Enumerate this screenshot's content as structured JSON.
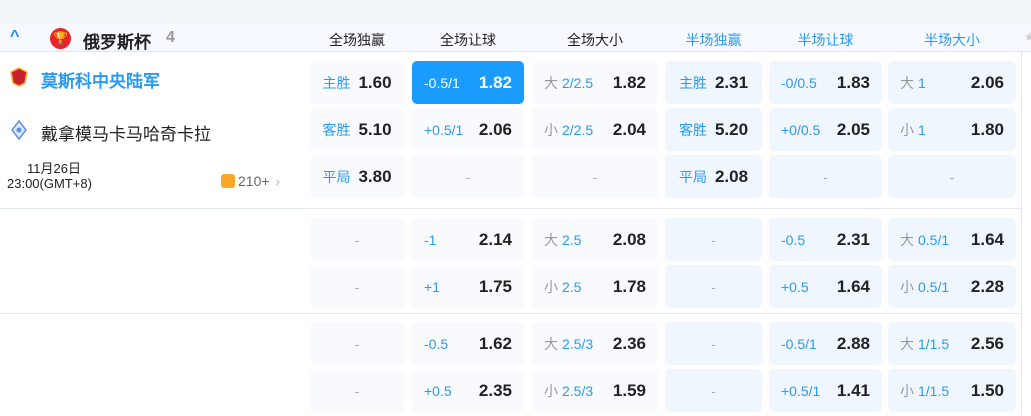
{
  "league": {
    "name": "俄罗斯杯",
    "count": "4",
    "icon": "trophy-icon",
    "color": "#e8232a"
  },
  "columns": [
    {
      "label": "全场独赢",
      "type": "ft"
    },
    {
      "label": "全场让球",
      "type": "ft"
    },
    {
      "label": "全场大小",
      "type": "ft"
    },
    {
      "label": "半场独赢",
      "type": "ht"
    },
    {
      "label": "半场让球",
      "type": "ht"
    },
    {
      "label": "半场大小",
      "type": "ht"
    }
  ],
  "match": {
    "home": "莫斯科中央陆军",
    "away": "戴拿模马卡马哈奇卡拉",
    "date": "11月26日",
    "time": "23:00(GMT+8)",
    "more": "210+"
  },
  "colors": {
    "accent": "#1a9cff",
    "blue_text": "#2b9af3"
  },
  "groups": [
    [
      [
        {
          "pre": "",
          "line": "主胜",
          "odds": "1.60"
        },
        {
          "pre": "",
          "line": "-0.5/1",
          "odds": "1.82",
          "selected": true
        },
        {
          "pre": "大",
          "line": "2/2.5",
          "odds": "1.82"
        },
        {
          "pre": "",
          "line": "主胜",
          "odds": "2.31"
        },
        {
          "pre": "",
          "line": "-0/0.5",
          "odds": "1.83"
        },
        {
          "pre": "大",
          "line": "1",
          "odds": "2.06"
        }
      ],
      [
        {
          "pre": "",
          "line": "客胜",
          "odds": "5.10"
        },
        {
          "pre": "",
          "line": "+0.5/1",
          "odds": "2.06"
        },
        {
          "pre": "小",
          "line": "2/2.5",
          "odds": "2.04"
        },
        {
          "pre": "",
          "line": "客胜",
          "odds": "5.20"
        },
        {
          "pre": "",
          "line": "+0/0.5",
          "odds": "2.05"
        },
        {
          "pre": "小",
          "line": "1",
          "odds": "1.80"
        }
      ],
      [
        {
          "pre": "",
          "line": "平局",
          "odds": "3.80"
        },
        null,
        null,
        {
          "pre": "",
          "line": "平局",
          "odds": "2.08"
        },
        null,
        null
      ]
    ],
    [
      [
        null,
        {
          "pre": "",
          "line": "-1",
          "odds": "2.14"
        },
        {
          "pre": "大",
          "line": "2.5",
          "odds": "2.08"
        },
        null,
        {
          "pre": "",
          "line": "-0.5",
          "odds": "2.31"
        },
        {
          "pre": "大",
          "line": "0.5/1",
          "odds": "1.64"
        }
      ],
      [
        null,
        {
          "pre": "",
          "line": "+1",
          "odds": "1.75"
        },
        {
          "pre": "小",
          "line": "2.5",
          "odds": "1.78"
        },
        null,
        {
          "pre": "",
          "line": "+0.5",
          "odds": "1.64"
        },
        {
          "pre": "小",
          "line": "0.5/1",
          "odds": "2.28"
        }
      ]
    ],
    [
      [
        null,
        {
          "pre": "",
          "line": "-0.5",
          "odds": "1.62"
        },
        {
          "pre": "大",
          "line": "2.5/3",
          "odds": "2.36"
        },
        null,
        {
          "pre": "",
          "line": "-0.5/1",
          "odds": "2.88"
        },
        {
          "pre": "大",
          "line": "1/1.5",
          "odds": "2.56"
        }
      ],
      [
        null,
        {
          "pre": "",
          "line": "+0.5",
          "odds": "2.35"
        },
        {
          "pre": "小",
          "line": "2.5/3",
          "odds": "1.59"
        },
        null,
        {
          "pre": "",
          "line": "+0.5/1",
          "odds": "1.41"
        },
        {
          "pre": "小",
          "line": "1/1.5",
          "odds": "1.50"
        }
      ]
    ]
  ],
  "empty": "-"
}
